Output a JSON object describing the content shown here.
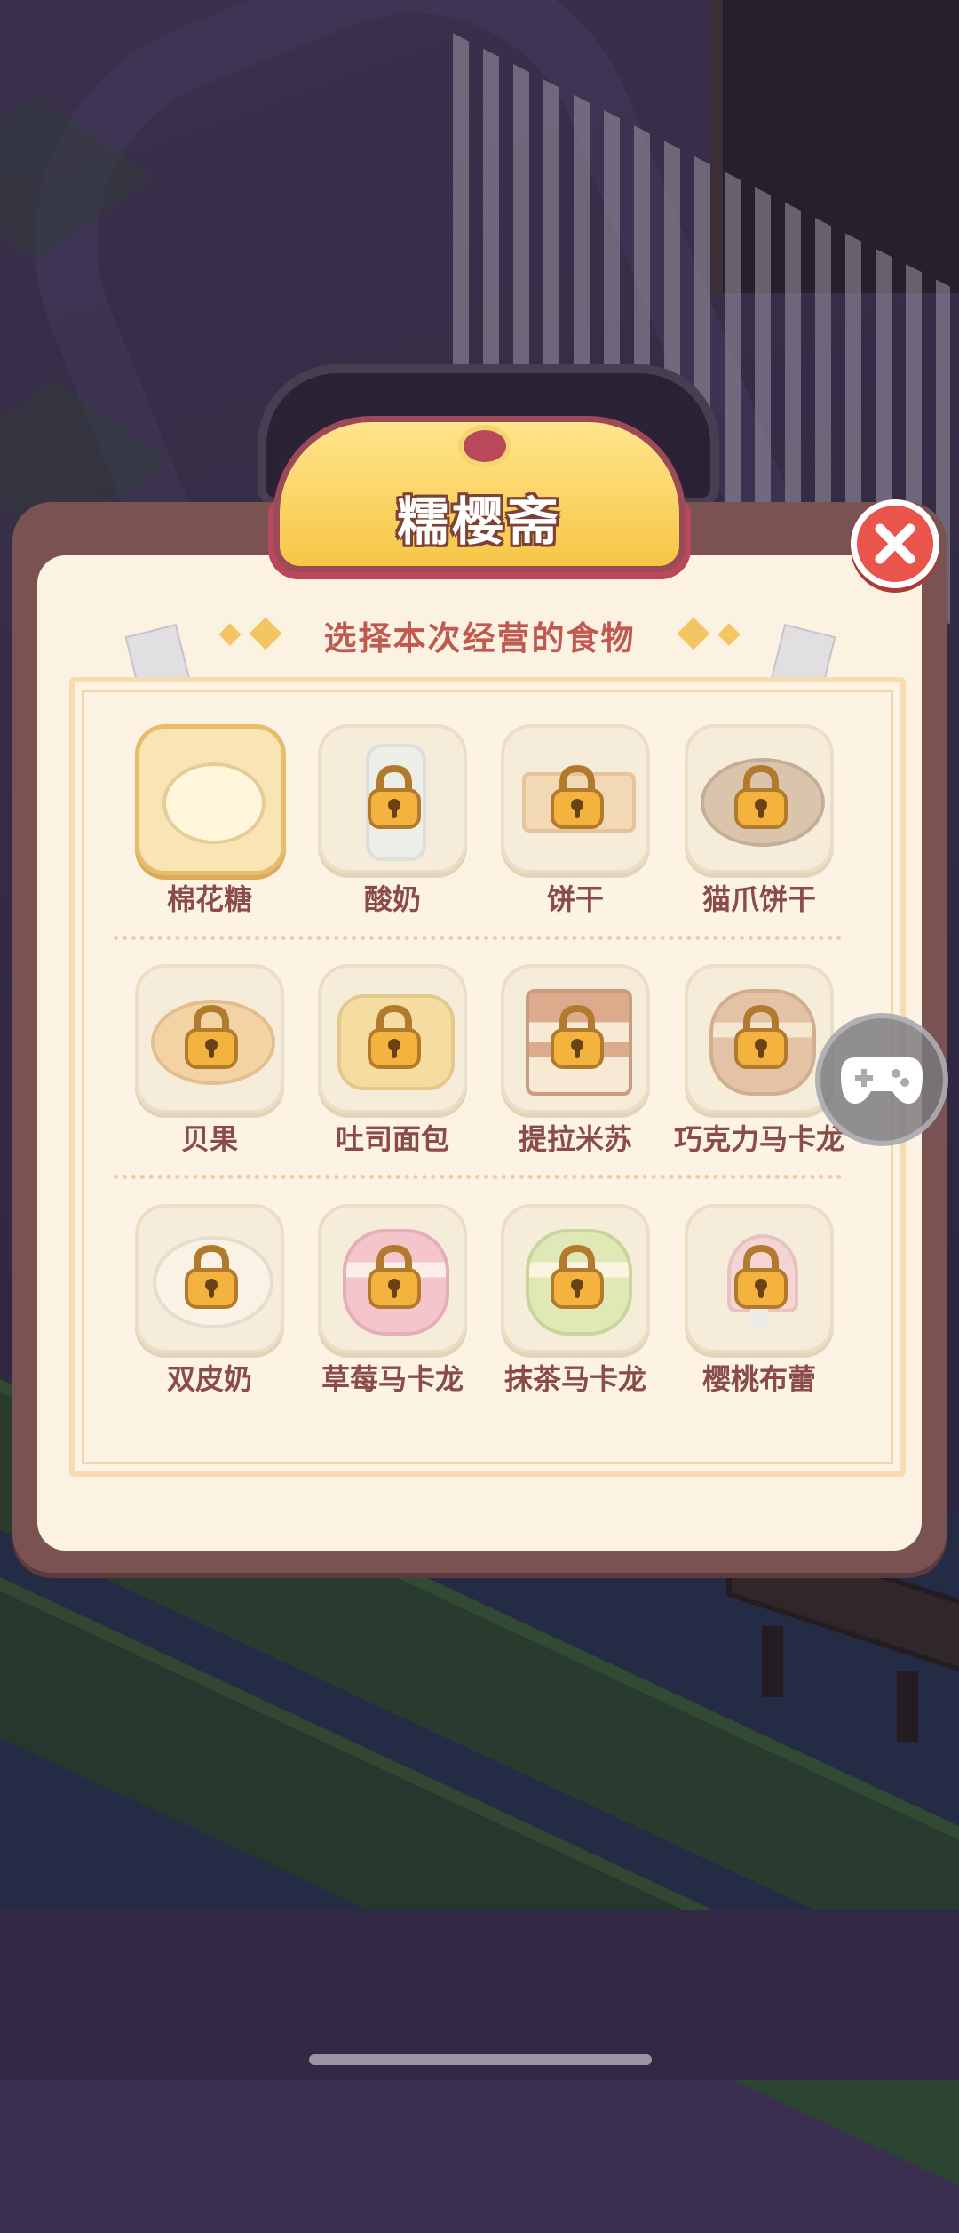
{
  "dialog": {
    "title": "糯樱斋",
    "subtitle": "选择本次经营的食物",
    "close_icon": "close-icon"
  },
  "foods": [
    {
      "label": "棉花糖",
      "locked": false,
      "selected": true,
      "icon": "marshmallow-icon"
    },
    {
      "label": "酸奶",
      "locked": true,
      "selected": false,
      "icon": "yogurt-icon"
    },
    {
      "label": "饼干",
      "locked": true,
      "selected": false,
      "icon": "cookie-icon"
    },
    {
      "label": "猫爪饼干",
      "locked": true,
      "selected": false,
      "icon": "cat-paw-cookie-icon"
    },
    {
      "label": "贝果",
      "locked": true,
      "selected": false,
      "icon": "bagel-icon"
    },
    {
      "label": "吐司面包",
      "locked": true,
      "selected": false,
      "icon": "toast-icon"
    },
    {
      "label": "提拉米苏",
      "locked": true,
      "selected": false,
      "icon": "tiramisu-icon"
    },
    {
      "label": "巧克力马卡龙",
      "locked": true,
      "selected": false,
      "icon": "chocolate-macaron-icon"
    },
    {
      "label": "双皮奶",
      "locked": true,
      "selected": false,
      "icon": "double-skin-milk-icon"
    },
    {
      "label": "草莓马卡龙",
      "locked": true,
      "selected": false,
      "icon": "strawberry-macaron-icon"
    },
    {
      "label": "抹茶马卡龙",
      "locked": true,
      "selected": false,
      "icon": "matcha-macaron-icon"
    },
    {
      "label": "樱桃布蕾",
      "locked": true,
      "selected": false,
      "icon": "cherry-pudding-icon"
    }
  ],
  "overlay": {
    "gamepad_icon": "gamepad-icon"
  },
  "colors": {
    "accent": "#e9554a",
    "title_plate": "#f7c646",
    "panel": "#7a5252",
    "label": "#8a4c47"
  }
}
